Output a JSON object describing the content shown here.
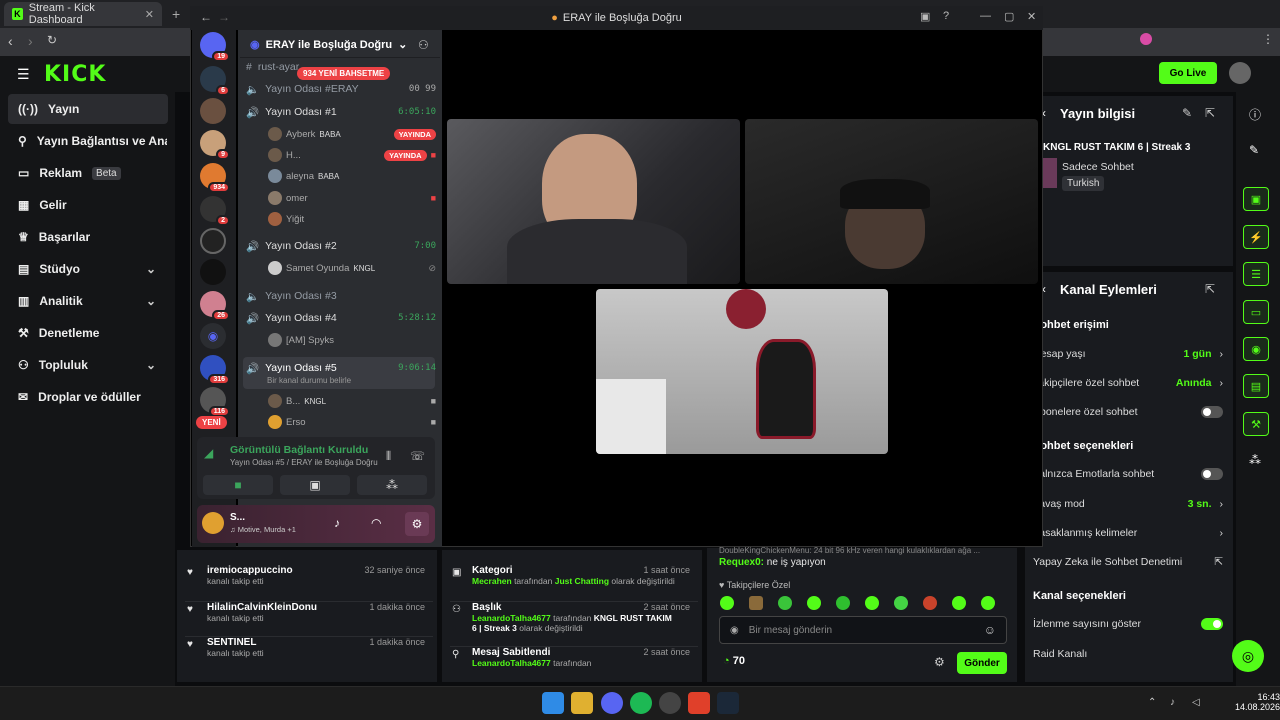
{
  "browser": {
    "tab_title": "Stream - Kick Dashboard"
  },
  "kick": {
    "logo": "KICK",
    "go_live": "Go Live",
    "sidebar": [
      {
        "label": "Yayın",
        "icon": "broadcast-icon"
      },
      {
        "label": "Yayın Bağlantısı ve Anahtarı",
        "icon": "link-icon"
      },
      {
        "label": "Reklam",
        "icon": "ad-icon",
        "badge": "Beta"
      },
      {
        "label": "Gelir",
        "icon": "revenue-icon"
      },
      {
        "label": "Başarılar",
        "icon": "trophy-icon"
      },
      {
        "label": "Stüdyo",
        "icon": "studio-icon"
      },
      {
        "label": "Analitik",
        "icon": "analytics-icon"
      },
      {
        "label": "Denetleme",
        "icon": "moderation-icon"
      },
      {
        "label": "Topluluk",
        "icon": "community-icon"
      },
      {
        "label": "Droplar ve ödüller",
        "icon": "gift-icon"
      }
    ],
    "followers": [
      {
        "name": "iremiocappuccino",
        "sub": "kanalı takip etti",
        "time": "32 saniye önce"
      },
      {
        "name": "HilalinCalvinKleinDonu",
        "sub": "kanalı takip etti",
        "time": "1 dakika önce"
      },
      {
        "name": "SENTINEL",
        "sub": "kanalı takip etti",
        "time": "1 dakika önce"
      }
    ],
    "activity": [
      {
        "title": "Kategori",
        "time": "1 saat önce",
        "user": "Mecrahen",
        "mid": "tarafından",
        "value": "Just Chatting",
        "tail": "olarak değiştirildi"
      },
      {
        "title": "Başlık",
        "time": "2 saat önce",
        "user": "LeanardoTalha4677",
        "mid": "tarafından",
        "value": "KNGL RUST TAKIM 6 | Streak 3",
        "tail": "olarak değiştirildi"
      },
      {
        "title": "Mesaj Sabitlendi",
        "time": "2 saat önce",
        "user": "LeanardoTalha4677",
        "mid": "tarafından"
      }
    ],
    "chat": {
      "top_line": "DoubleKingChickenMenu: 24 bit 96 kHz veren hangi kulaklıklardan ağa ...",
      "msg_user": "Requex0:",
      "msg_text": "ne iş yapıyon",
      "followers_only": "Takipçilere Özel",
      "placeholder": "Bir mesaj gönderin",
      "count": "70",
      "send": "Gönder"
    },
    "stream_info": {
      "title": "Yayın bilgisi",
      "stream_title": "KNGL RUST TAKIM 6 | Streak 3",
      "category": "Sadece Sohbet",
      "language": "Turkish"
    },
    "channel_actions": {
      "title": "Kanal Eylemleri",
      "chat_access": "Sohbet erişimi",
      "rows": [
        {
          "label": "Hesap yaşı",
          "value": "1 gün"
        },
        {
          "label": "Takipçilere özel sohbet",
          "value": "Anında"
        },
        {
          "label": "Abonelere özel sohbet"
        }
      ],
      "chat_options": "Sohbet seçenekleri",
      "rows2": [
        {
          "label": "Yalnızca Emotlarla sohbet"
        },
        {
          "label": "Yavaş mod",
          "value": "3 sn."
        },
        {
          "label": "Yasaklanmış kelimeler"
        },
        {
          "label": "Yapay Zeka ile Sohbet Denetimi"
        }
      ],
      "channel_options": "Kanal seçenekleri",
      "rows3": [
        {
          "label": "İzlenme sayısını göster"
        },
        {
          "label": "Raid Kanalı"
        }
      ]
    }
  },
  "discord": {
    "window_title": "ERAY ile Boşluğa Doğru",
    "server_name": "ERAY ile Boşluğa Doğru",
    "mentions": "934 YENİ BAHSETME",
    "new_label": "YENİ",
    "guild_badges": [
      "19",
      "6",
      "9",
      "934",
      "2",
      "26",
      "316",
      "116"
    ],
    "channels": [
      {
        "name": "rust-ayar",
        "type": "text"
      },
      {
        "name": "Yayın Odası #ERAY",
        "type": "voice",
        "time": "00 99"
      },
      {
        "name": "Yayın Odası #1",
        "type": "voice",
        "time": "6:05:10"
      },
      {
        "name": "Yayın Odası #2",
        "type": "voice",
        "time": "7:00"
      },
      {
        "name": "Yayın Odası #3",
        "type": "voice"
      },
      {
        "name": "Yayın Odası #4",
        "type": "voice",
        "time": "5:28:12"
      },
      {
        "name": "Yayın Odası #5",
        "type": "voice",
        "time": "9:06:14",
        "status": "Bir kanal durumu belirle"
      }
    ],
    "users_room1": [
      {
        "name": "Ayberk",
        "tag": "BABA",
        "live": "YAYINDA"
      },
      {
        "name": "H...",
        "live": "YAYINDA"
      },
      {
        "name": "aleyna",
        "tag": "BABA"
      },
      {
        "name": "omer"
      },
      {
        "name": "Yiğit"
      }
    ],
    "user_room2": {
      "name": "Samet Oyunda",
      "tag": "KNGL"
    },
    "user_room4": {
      "name": "[AM] Spyks"
    },
    "users_room5": [
      {
        "name": "B...",
        "tag": "KNGL"
      },
      {
        "name": "Erso"
      }
    ],
    "voice_status": "Görüntülü Bağlantı Kuruldu",
    "voice_sub": "Yayın Odası #5 / ERAY ile Boşluğa Doğru",
    "user": {
      "name": "S...",
      "status": "Motive, Murda +1"
    }
  },
  "taskbar": {
    "time": "16:43",
    "date": "14.08.2026"
  },
  "colors": {
    "kick_green": "#53fc18",
    "discord_bg": "#2b2d31",
    "live_red": "#ed4245"
  }
}
